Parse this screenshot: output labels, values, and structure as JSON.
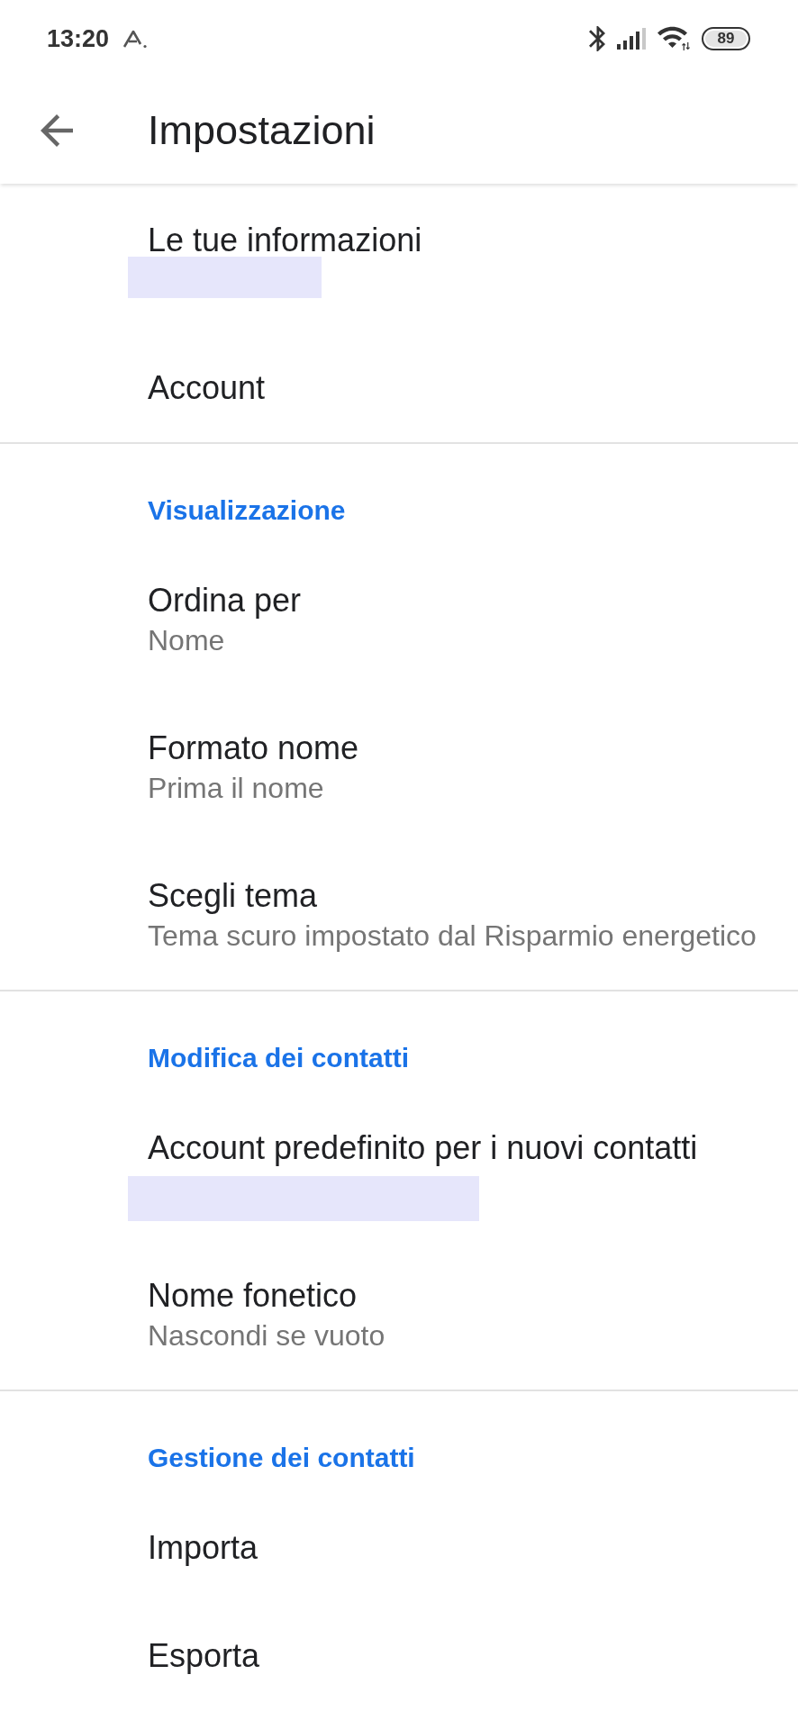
{
  "status_bar": {
    "time": "13:20",
    "battery": "89"
  },
  "app_bar": {
    "title": "Impostazioni"
  },
  "sections": [
    {
      "items": [
        {
          "kind": "redacted",
          "title": "Le tue informazioni"
        },
        {
          "kind": "single",
          "title": "Account"
        }
      ]
    },
    {
      "header": "Visualizzazione",
      "items": [
        {
          "kind": "detail",
          "title": "Ordina per",
          "subtitle": "Nome"
        },
        {
          "kind": "detail",
          "title": "Formato nome",
          "subtitle": "Prima il nome"
        },
        {
          "kind": "detail",
          "title": "Scegli tema",
          "subtitle": "Tema scuro impostato dal Risparmio energetico"
        }
      ]
    },
    {
      "header": "Modifica dei contatti",
      "items": [
        {
          "kind": "redacted_wide",
          "title": "Account predefinito per i nuovi contatti"
        },
        {
          "kind": "detail",
          "title": "Nome fonetico",
          "subtitle": "Nascondi se vuoto"
        }
      ]
    },
    {
      "header": "Gestione dei contatti",
      "items": [
        {
          "kind": "single",
          "title": "Importa"
        },
        {
          "kind": "single",
          "title": "Esporta"
        }
      ]
    }
  ]
}
